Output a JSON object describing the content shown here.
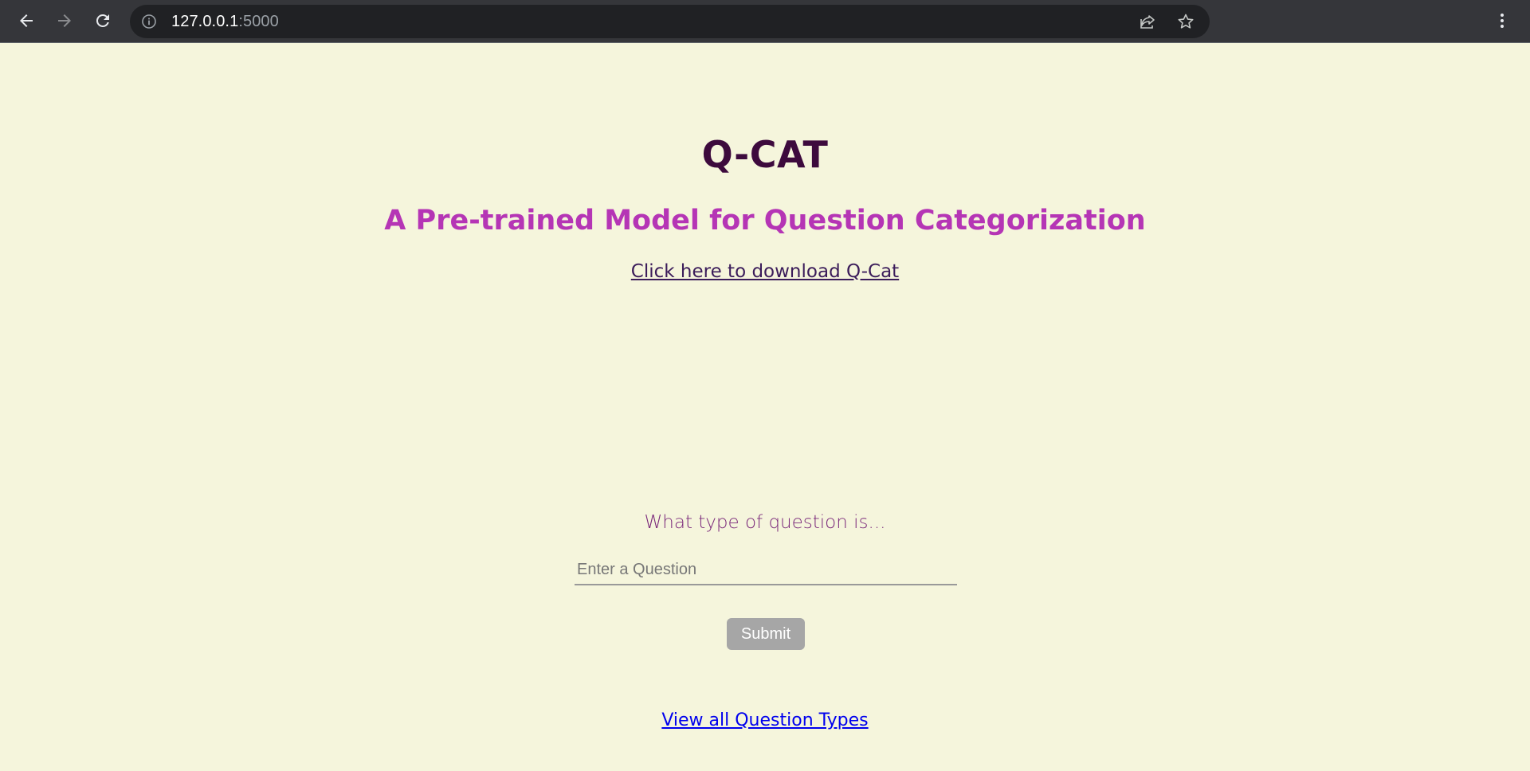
{
  "browser": {
    "url_host": "127.0.0.1",
    "url_port": ":5000",
    "icons": {
      "back": "back-arrow-icon",
      "forward": "forward-arrow-icon",
      "reload": "reload-icon",
      "info": "info-icon",
      "share": "share-icon",
      "star": "star-icon",
      "menu": "kebab-menu-icon"
    }
  },
  "page": {
    "title": "Q-CAT",
    "subtitle": "A Pre-trained Model for Question Categorization",
    "download_link": "Click here to download Q-Cat",
    "prompt": "What type of question is...",
    "question_input": {
      "value": "",
      "placeholder": "Enter a Question"
    },
    "submit_label": "Submit",
    "view_types_link": "View all Question Types"
  },
  "colors": {
    "background": "#f5f5dc",
    "title": "#3d0a3d",
    "subtitle": "#b535b5",
    "download_link": "#3b1c5a",
    "prompt": "#7a287a",
    "submit_bg": "#a6a6a6",
    "view_types_link": "#0000ee"
  }
}
